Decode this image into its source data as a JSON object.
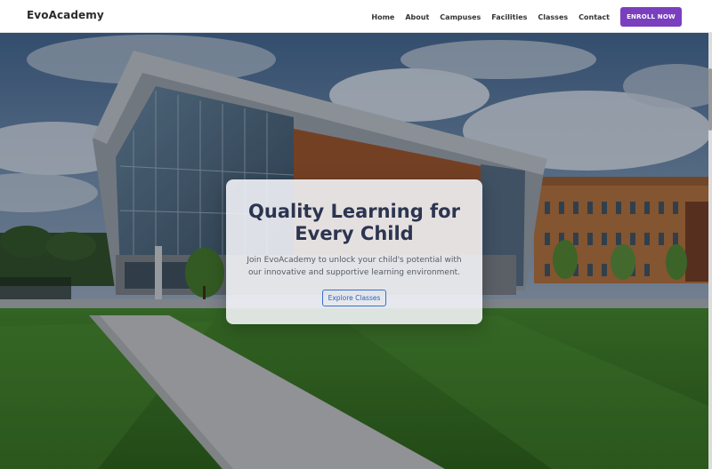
{
  "brand": "EvoAcademy",
  "nav": {
    "links": [
      "Home",
      "About",
      "Campuses",
      "Facilities",
      "Classes",
      "Contact"
    ],
    "cta": "ENROLL NOW",
    "cta_color": "#7a3fbf"
  },
  "hero": {
    "title": "Quality Learning for Every Child",
    "text": "Join EvoAcademy to unlock your child's potential with our innovative and supportive learning environment.",
    "button": "Explore Classes",
    "background": "school-building-photo"
  }
}
